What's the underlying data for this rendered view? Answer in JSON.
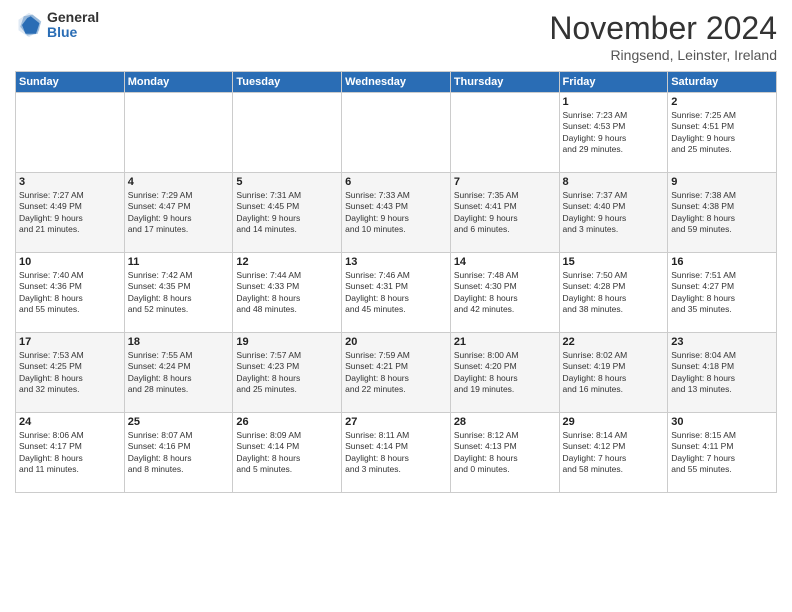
{
  "logo": {
    "general": "General",
    "blue": "Blue"
  },
  "header": {
    "month": "November 2024",
    "location": "Ringsend, Leinster, Ireland"
  },
  "weekdays": [
    "Sunday",
    "Monday",
    "Tuesday",
    "Wednesday",
    "Thursday",
    "Friday",
    "Saturday"
  ],
  "weeks": [
    [
      {
        "day": "",
        "info": ""
      },
      {
        "day": "",
        "info": ""
      },
      {
        "day": "",
        "info": ""
      },
      {
        "day": "",
        "info": ""
      },
      {
        "day": "",
        "info": ""
      },
      {
        "day": "1",
        "info": "Sunrise: 7:23 AM\nSunset: 4:53 PM\nDaylight: 9 hours\nand 29 minutes."
      },
      {
        "day": "2",
        "info": "Sunrise: 7:25 AM\nSunset: 4:51 PM\nDaylight: 9 hours\nand 25 minutes."
      }
    ],
    [
      {
        "day": "3",
        "info": "Sunrise: 7:27 AM\nSunset: 4:49 PM\nDaylight: 9 hours\nand 21 minutes."
      },
      {
        "day": "4",
        "info": "Sunrise: 7:29 AM\nSunset: 4:47 PM\nDaylight: 9 hours\nand 17 minutes."
      },
      {
        "day": "5",
        "info": "Sunrise: 7:31 AM\nSunset: 4:45 PM\nDaylight: 9 hours\nand 14 minutes."
      },
      {
        "day": "6",
        "info": "Sunrise: 7:33 AM\nSunset: 4:43 PM\nDaylight: 9 hours\nand 10 minutes."
      },
      {
        "day": "7",
        "info": "Sunrise: 7:35 AM\nSunset: 4:41 PM\nDaylight: 9 hours\nand 6 minutes."
      },
      {
        "day": "8",
        "info": "Sunrise: 7:37 AM\nSunset: 4:40 PM\nDaylight: 9 hours\nand 3 minutes."
      },
      {
        "day": "9",
        "info": "Sunrise: 7:38 AM\nSunset: 4:38 PM\nDaylight: 8 hours\nand 59 minutes."
      }
    ],
    [
      {
        "day": "10",
        "info": "Sunrise: 7:40 AM\nSunset: 4:36 PM\nDaylight: 8 hours\nand 55 minutes."
      },
      {
        "day": "11",
        "info": "Sunrise: 7:42 AM\nSunset: 4:35 PM\nDaylight: 8 hours\nand 52 minutes."
      },
      {
        "day": "12",
        "info": "Sunrise: 7:44 AM\nSunset: 4:33 PM\nDaylight: 8 hours\nand 48 minutes."
      },
      {
        "day": "13",
        "info": "Sunrise: 7:46 AM\nSunset: 4:31 PM\nDaylight: 8 hours\nand 45 minutes."
      },
      {
        "day": "14",
        "info": "Sunrise: 7:48 AM\nSunset: 4:30 PM\nDaylight: 8 hours\nand 42 minutes."
      },
      {
        "day": "15",
        "info": "Sunrise: 7:50 AM\nSunset: 4:28 PM\nDaylight: 8 hours\nand 38 minutes."
      },
      {
        "day": "16",
        "info": "Sunrise: 7:51 AM\nSunset: 4:27 PM\nDaylight: 8 hours\nand 35 minutes."
      }
    ],
    [
      {
        "day": "17",
        "info": "Sunrise: 7:53 AM\nSunset: 4:25 PM\nDaylight: 8 hours\nand 32 minutes."
      },
      {
        "day": "18",
        "info": "Sunrise: 7:55 AM\nSunset: 4:24 PM\nDaylight: 8 hours\nand 28 minutes."
      },
      {
        "day": "19",
        "info": "Sunrise: 7:57 AM\nSunset: 4:23 PM\nDaylight: 8 hours\nand 25 minutes."
      },
      {
        "day": "20",
        "info": "Sunrise: 7:59 AM\nSunset: 4:21 PM\nDaylight: 8 hours\nand 22 minutes."
      },
      {
        "day": "21",
        "info": "Sunrise: 8:00 AM\nSunset: 4:20 PM\nDaylight: 8 hours\nand 19 minutes."
      },
      {
        "day": "22",
        "info": "Sunrise: 8:02 AM\nSunset: 4:19 PM\nDaylight: 8 hours\nand 16 minutes."
      },
      {
        "day": "23",
        "info": "Sunrise: 8:04 AM\nSunset: 4:18 PM\nDaylight: 8 hours\nand 13 minutes."
      }
    ],
    [
      {
        "day": "24",
        "info": "Sunrise: 8:06 AM\nSunset: 4:17 PM\nDaylight: 8 hours\nand 11 minutes."
      },
      {
        "day": "25",
        "info": "Sunrise: 8:07 AM\nSunset: 4:16 PM\nDaylight: 8 hours\nand 8 minutes."
      },
      {
        "day": "26",
        "info": "Sunrise: 8:09 AM\nSunset: 4:14 PM\nDaylight: 8 hours\nand 5 minutes."
      },
      {
        "day": "27",
        "info": "Sunrise: 8:11 AM\nSunset: 4:14 PM\nDaylight: 8 hours\nand 3 minutes."
      },
      {
        "day": "28",
        "info": "Sunrise: 8:12 AM\nSunset: 4:13 PM\nDaylight: 8 hours\nand 0 minutes."
      },
      {
        "day": "29",
        "info": "Sunrise: 8:14 AM\nSunset: 4:12 PM\nDaylight: 7 hours\nand 58 minutes."
      },
      {
        "day": "30",
        "info": "Sunrise: 8:15 AM\nSunset: 4:11 PM\nDaylight: 7 hours\nand 55 minutes."
      }
    ]
  ]
}
